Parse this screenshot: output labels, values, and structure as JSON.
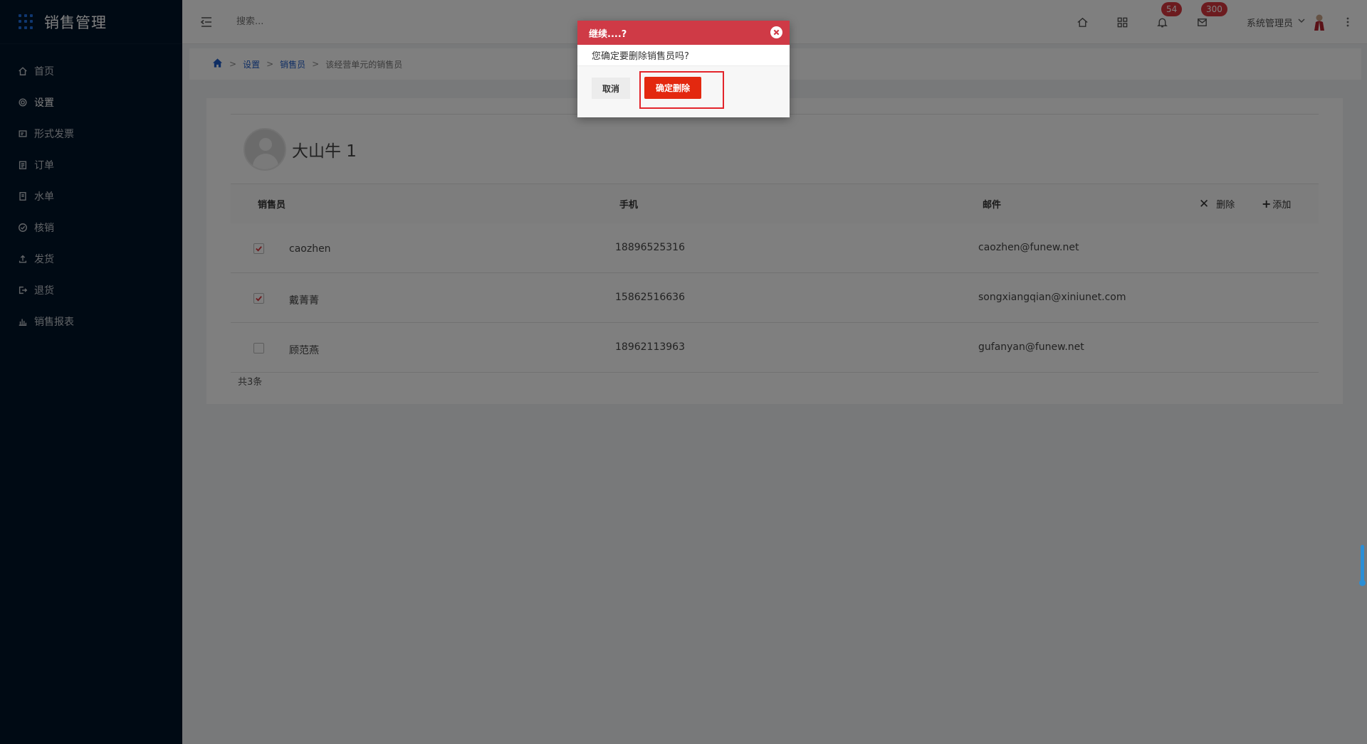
{
  "app": {
    "title": "销售管理",
    "brand_color": "#001529",
    "accent_color": "#1f5cc9"
  },
  "sidebar": {
    "items": [
      {
        "label": "首页",
        "icon": "home-icon"
      },
      {
        "label": "设置",
        "icon": "gear-icon",
        "active": true
      },
      {
        "label": "形式发票",
        "icon": "invoice-icon"
      },
      {
        "label": "订单",
        "icon": "order-icon"
      },
      {
        "label": "水单",
        "icon": "receipt-icon"
      },
      {
        "label": "核销",
        "icon": "check-circle-icon"
      },
      {
        "label": "发货",
        "icon": "upload-icon"
      },
      {
        "label": "退货",
        "icon": "logout-icon"
      },
      {
        "label": "销售报表",
        "icon": "bar-chart-icon"
      }
    ]
  },
  "header": {
    "search_placeholder": "搜索...",
    "notifications_count": "54",
    "messages_count": "300",
    "user_name": "系统管理员"
  },
  "breadcrumb": {
    "items": [
      "设置",
      "销售员"
    ],
    "current": "该经营单元的销售员"
  },
  "profile": {
    "name": "大山牛 1"
  },
  "table": {
    "columns": {
      "name": "销售员",
      "phone": "手机",
      "email": "邮件"
    },
    "delete_label": "删除",
    "add_label": "添加",
    "rows": [
      {
        "checked": true,
        "name": "caozhen",
        "phone": "18896525316",
        "email": "caozhen@funew.net"
      },
      {
        "checked": true,
        "name": "戴菁菁",
        "phone": "15862516636",
        "email": "songxiangqian@xiniunet.com"
      },
      {
        "checked": false,
        "name": "顾范燕",
        "phone": "18962113963",
        "email": "gufanyan@funew.net"
      }
    ],
    "total": "共3条"
  },
  "dialog": {
    "title": "继续....?",
    "message": "您确定要删除销售员吗?",
    "cancel_label": "取消",
    "confirm_label": "确定删除",
    "header_color": "#cf3a46",
    "confirm_color": "#e3280f"
  }
}
